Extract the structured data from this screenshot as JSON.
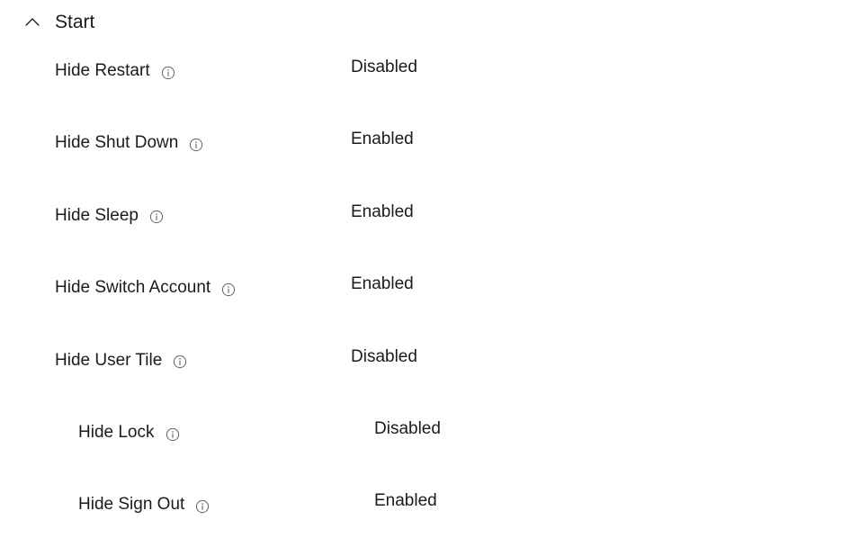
{
  "section": {
    "title": "Start",
    "expanded": true,
    "icon": "chevron-up-icon"
  },
  "settings": [
    {
      "label": "Hide Restart",
      "value": "Disabled",
      "indent": 0
    },
    {
      "label": "Hide Shut Down",
      "value": "Enabled",
      "indent": 0
    },
    {
      "label": "Hide Sleep",
      "value": "Enabled",
      "indent": 0
    },
    {
      "label": "Hide Switch Account",
      "value": "Enabled",
      "indent": 0
    },
    {
      "label": "Hide User Tile",
      "value": "Disabled",
      "indent": 0
    },
    {
      "label": "Hide Lock",
      "value": "Disabled",
      "indent": 1
    },
    {
      "label": "Hide Sign Out",
      "value": "Enabled",
      "indent": 1
    }
  ],
  "colors": {
    "text": "#1b1b1b",
    "icon": "#616161",
    "background": "#ffffff"
  }
}
